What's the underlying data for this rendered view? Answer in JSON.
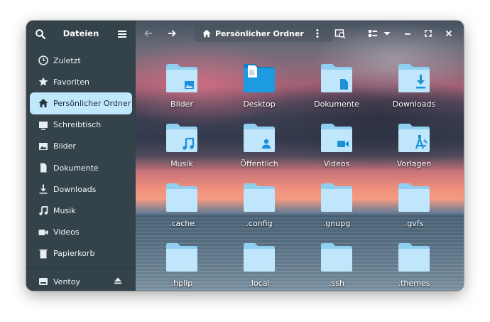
{
  "sidebar": {
    "title": "Dateien",
    "search_icon": "search-icon",
    "menu_icon": "hamburger-menu-icon",
    "items": [
      {
        "label": "Zuletzt",
        "icon": "clock-icon"
      },
      {
        "label": "Favoriten",
        "icon": "star-icon"
      },
      {
        "label": "Persönlicher Ordner",
        "icon": "home-icon",
        "active": true
      },
      {
        "label": "Schreibtisch",
        "icon": "desktop-icon"
      },
      {
        "label": "Bilder",
        "icon": "image-icon"
      },
      {
        "label": "Dokumente",
        "icon": "document-icon"
      },
      {
        "label": "Downloads",
        "icon": "download-icon"
      },
      {
        "label": "Musik",
        "icon": "music-icon"
      },
      {
        "label": "Videos",
        "icon": "video-icon"
      },
      {
        "label": "Papierkorb",
        "icon": "trash-icon"
      }
    ],
    "device": {
      "label": "Ventoy",
      "icon": "drive-icon",
      "eject_icon": "eject-icon"
    }
  },
  "header": {
    "location": "Persönlicher Ordner",
    "location_icon": "home-icon"
  },
  "colors": {
    "accent": "#bfe8fb",
    "sidebar_bg": "#34424a",
    "folder": "#bfe6fa",
    "folder_dark": "#8fd0f0",
    "folder_glyph": "#1e8fd9",
    "desktop_blue": "#1c9be0"
  },
  "files": [
    {
      "name": "Bilder",
      "icon": "image-folder-icon"
    },
    {
      "name": "Desktop",
      "icon": "desktop-folder-icon"
    },
    {
      "name": "Dokumente",
      "icon": "document-folder-icon"
    },
    {
      "name": "Downloads",
      "icon": "download-folder-icon"
    },
    {
      "name": "Musik",
      "icon": "music-folder-icon"
    },
    {
      "name": "Öffentlich",
      "icon": "public-folder-icon"
    },
    {
      "name": "Videos",
      "icon": "video-folder-icon"
    },
    {
      "name": "Vorlagen",
      "icon": "templates-folder-icon"
    },
    {
      "name": ".cache",
      "icon": "folder-icon"
    },
    {
      "name": ".config",
      "icon": "folder-icon"
    },
    {
      "name": ".gnupg",
      "icon": "folder-icon"
    },
    {
      "name": ".gvfs",
      "icon": "folder-icon"
    },
    {
      "name": ".hplip",
      "icon": "folder-icon"
    },
    {
      "name": ".local",
      "icon": "folder-icon"
    },
    {
      "name": ".ssh",
      "icon": "folder-icon"
    },
    {
      "name": ".themes",
      "icon": "folder-icon"
    }
  ]
}
